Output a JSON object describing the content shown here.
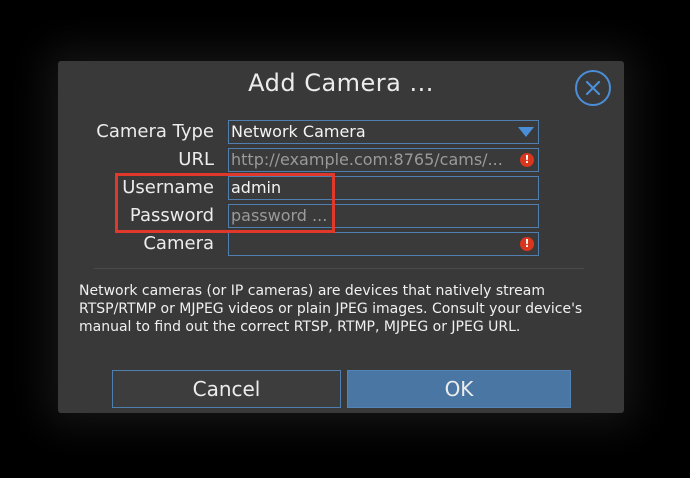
{
  "dialog": {
    "title": "Add Camera ...",
    "close_icon": "close-circle-icon",
    "fields": {
      "camera_type": {
        "label": "Camera Type",
        "value": "Network Camera"
      },
      "url": {
        "label": "URL",
        "placeholder": "http://example.com:8765/cams/...",
        "error_icon": "error-icon"
      },
      "username": {
        "label": "Username",
        "value": "admin"
      },
      "password": {
        "label": "Password",
        "placeholder": "password ..."
      },
      "camera": {
        "label": "Camera",
        "value": "",
        "error_icon": "error-icon"
      }
    },
    "description": "Network cameras (or IP cameras) are devices that natively stream RTSP/RTMP or MJPEG videos or plain JPEG images. Consult your device's manual to find out the correct RTSP, RTMP, MJPEG or JPEG URL.",
    "buttons": {
      "cancel": "Cancel",
      "ok": "OK"
    }
  },
  "annotation": {
    "highlight_color": "#e0392b"
  },
  "colors": {
    "accent": "#4a8ed8",
    "ok_button": "#4a76a4",
    "error": "#d9361e",
    "dialog_bg": "#393939"
  }
}
